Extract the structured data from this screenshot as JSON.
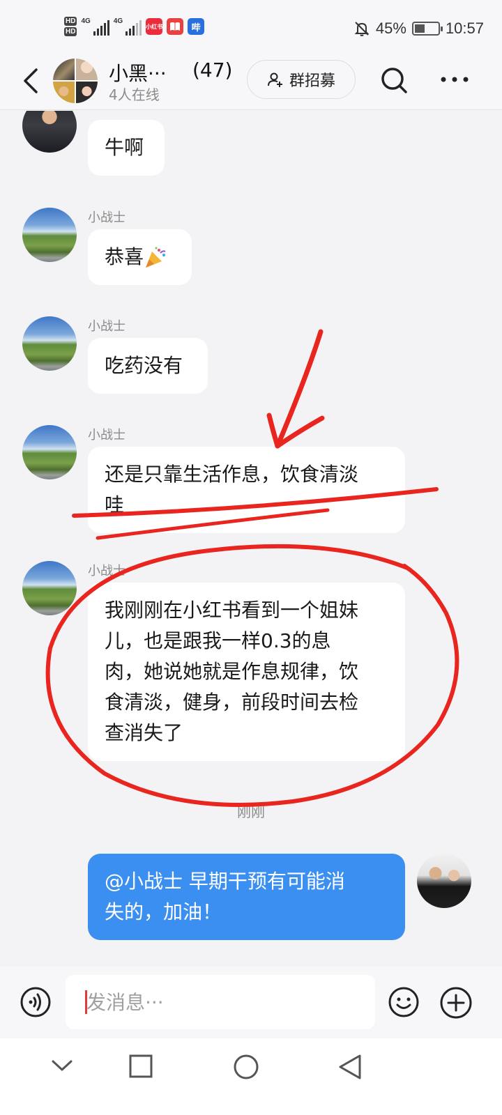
{
  "status_bar": {
    "hd1": "HD",
    "hd2": "HD",
    "net1": "4G",
    "net2": "4G",
    "app_icon_1": "小红书",
    "app_icon_2": "book-icon",
    "app_icon_3": "哔",
    "battery_percent_text": "45%",
    "battery_level": 0.45,
    "time": "10:57"
  },
  "header": {
    "title": "小黑···",
    "member_count": "(47)",
    "online": "4人在线",
    "recruit_label": "群招募"
  },
  "chat": {
    "messages": [
      {
        "sender": "",
        "text": "牛啊"
      },
      {
        "sender": "小战士",
        "text": "恭喜"
      },
      {
        "sender": "小战士",
        "text": "吃药没有"
      },
      {
        "sender": "小战士",
        "line1": "还是只靠生活作息，饮食清淡",
        "line2": "哇"
      },
      {
        "sender": "小战士",
        "line1": "我刚刚在小红书看到一个姐妹",
        "line2": "儿，也是跟我一样0.3的息",
        "line3": "肉，她说她就是作息规律，饮",
        "line4": "食清淡，健身，前段时间去检",
        "line5": "查消失了"
      }
    ],
    "timestamp": "刚刚",
    "my_message": {
      "line1": "@小战士  早期干预有可能消",
      "line2": "失的，加油！"
    }
  },
  "input": {
    "placeholder": "发消息···"
  },
  "colors": {
    "my_bubble": "#3a8ff0",
    "annotation_red": "#e8261f",
    "background": "#f3f3f5"
  }
}
